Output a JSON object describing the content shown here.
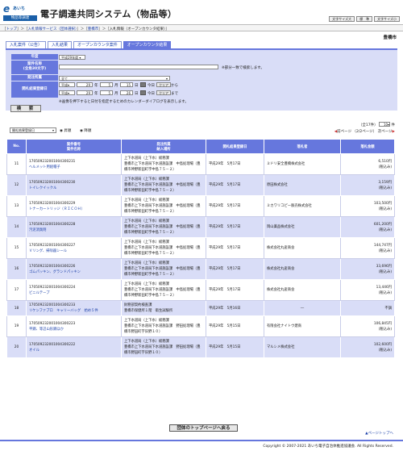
{
  "header": {
    "logo_mark": "e",
    "logo_top": "あいち",
    "logo_bottom": "物品等調達",
    "title": "電子調達共同システム（物品等）",
    "buttons": [
      "文字サイズ大",
      "標　準",
      "文字サイズ小"
    ]
  },
  "breadcrumb": [
    "トップ",
    "入札情報サービス（団体選択）",
    "豊橋市",
    "入札情報（オープンカウンタ結果）"
  ],
  "city": "豊橋市",
  "tabs": [
    "入札案件（公告）",
    "入札結果",
    "オープンカウンタ案件",
    "オープンカウンタ結果"
  ],
  "form": {
    "year_label": "年度",
    "year_value": "平成29年度",
    "name_label": "案件名称",
    "name_sub": "(全角30文字)",
    "name_note": "※部分一致で検索します。",
    "dept_label": "発注所属",
    "dept_value": "全て",
    "date_label": "開札結果登録日",
    "from_era": "平成",
    "from_y": "29",
    "from_m": "5",
    "from_d": "15",
    "to_era": "平成",
    "to_y": "29",
    "to_m": "5",
    "to_d": "26",
    "y_unit": "年",
    "m_unit": "月",
    "d_unit": "日",
    "today": "今日",
    "clear": "クリア",
    "from": "から",
    "to": "まで",
    "cal_note": "※画像を押下すると日付を指定するためのカレンダーダイアログを表示します。",
    "search_button": "検　索"
  },
  "controls": {
    "sort_value": "開札結果登録日",
    "asc": "昇順",
    "desc": "降順",
    "count_label": "（全17件）",
    "per_page": "10",
    "per_page_unit": "件",
    "prev": "前ページ",
    "page_info": "（2/2ページ）",
    "next": "次ページ"
  },
  "table": {
    "headers": {
      "no": "No.",
      "case_no": "案件番号",
      "case_name": "案件名称",
      "dept": "発注所属",
      "delivery": "納入場所",
      "date": "開札結果登録日",
      "bidder": "落札者",
      "amount": "落札金額"
    },
    "rows": [
      {
        "no": "11",
        "id": "170509232001004300231",
        "name": "ヘルメット用組帽子",
        "dept": "上下水道局（上下水）総務課",
        "place": "豊橋市上下水道局下水道施設課　中島処理場（豊橋市神野新田町字中島７５－２）",
        "date": "平成29年　5月17日",
        "bidder": "ミドリ安全豊橋株式会社",
        "amount": "6,510円",
        "tax": "(税込み)"
      },
      {
        "no": "12",
        "id": "170509232001004300230",
        "name": "トイレクイックル",
        "dept": "上下水道局（上下水）総務課",
        "place": "豊橋市上下水道局下水道施設課　中島処理場（豊橋市神野新田町字中島７５－２）",
        "date": "平成29年　5月17日",
        "bidder": "原田株式会社",
        "amount": "3,159円",
        "tax": "(税込み)"
      },
      {
        "no": "13",
        "id": "170509232001004300229",
        "name": "トナーカートリッジ（ＲＩＣＯＨ）",
        "dept": "上下水道局（上下水）総務課",
        "place": "豊橋市上下水道局下水道施設課　中島処理場（豊橋市神野新田町字中島７５－２）",
        "date": "平成29年　5月17日",
        "bidder": "ミカワリコピー販売株式会社",
        "amount": "103,500円",
        "tax": "(税込み)"
      },
      {
        "no": "14",
        "id": "170509232001004300228",
        "name": "汚泥消臭剤",
        "dept": "上下水道局（上下水）総務課",
        "place": "豊橋市上下水道局下水道施設課　中島処理場（豊橋市神野新田町字中島７５－２）",
        "date": "平成29年　5月17日",
        "bidder": "岡山薬品株式会社",
        "amount": "601,200円",
        "tax": "(税込み)"
      },
      {
        "no": "15",
        "id": "170509232001004300227",
        "name": "Ｖリング、掃除器シール",
        "dept": "上下水道局（上下水）総務課",
        "place": "豊橋市上下水道局下水道施設課　中島処理場（豊橋市神野新田町字中島７５－２）",
        "date": "平成29年　5月17日",
        "bidder": "株式会社丸産商会",
        "amount": "144,747円",
        "tax": "(税込み)"
      },
      {
        "no": "16",
        "id": "170509232001004300226",
        "name": "ゴムパッキン、グランドパッキン",
        "dept": "上下水道局（上下水）総務課",
        "place": "豊橋市上下水道局下水道施設課　中島処理場（豊橋市神野新田町字中島７５－２）",
        "date": "平成29年　5月17日",
        "bidder": "株式会社丸産商会",
        "amount": "33,696円",
        "tax": "(税込み)"
      },
      {
        "no": "17",
        "id": "170509232001004300224",
        "name": "ビニルテープ",
        "dept": "上下水道局（上下水）総務課",
        "place": "豊橋市上下水道局下水道施設課　中島処理場（豊橋市神野新田町字中島７５－２）",
        "date": "平成29年　5月17日",
        "bidder": "株式会社丸産商会",
        "amount": "13,446円",
        "tax": "(税込み)"
      },
      {
        "no": "18",
        "id": "170509232001004300233",
        "name": "リケンファブロ　キャリーバッグ　始め５件",
        "dept": "財務部契約検査課",
        "place": "豊橋市保健所１階　衛生試験所",
        "date": "平成29年　5月16日",
        "bidder": "―",
        "amount": "不調",
        "tax": ""
      },
      {
        "no": "19",
        "id": "170509232001004300223",
        "name": "平鋼、等辺山形鋼ほか",
        "dept": "上下水道局（上下水）総務課",
        "place": "豊橋市上下水道局下水道施設課　野田処理場（豊橋市野田町字旧野１０）",
        "date": "平成29年　5月15日",
        "bidder": "有限会社ナイトウ建商",
        "amount": "106,845円",
        "tax": "(税込み)"
      },
      {
        "no": "20",
        "id": "170509232001004300222",
        "name": "オイル",
        "dept": "上下水道局（上下水）総務課",
        "place": "豊橋市上下水道局下水道施設課　野田処理場（豊橋市野田町字旧野１０）",
        "date": "平成29年　5月15日",
        "bidder": "マルシメ株式会社",
        "amount": "102,600円",
        "tax": "(税込み)"
      }
    ]
  },
  "top_button": "団体のトップページへ戻る",
  "to_top": "▲ページトップへ",
  "footer": "Copyright © 2007-2021 あいち電子自治体推進協議会. All Rights Reserved."
}
